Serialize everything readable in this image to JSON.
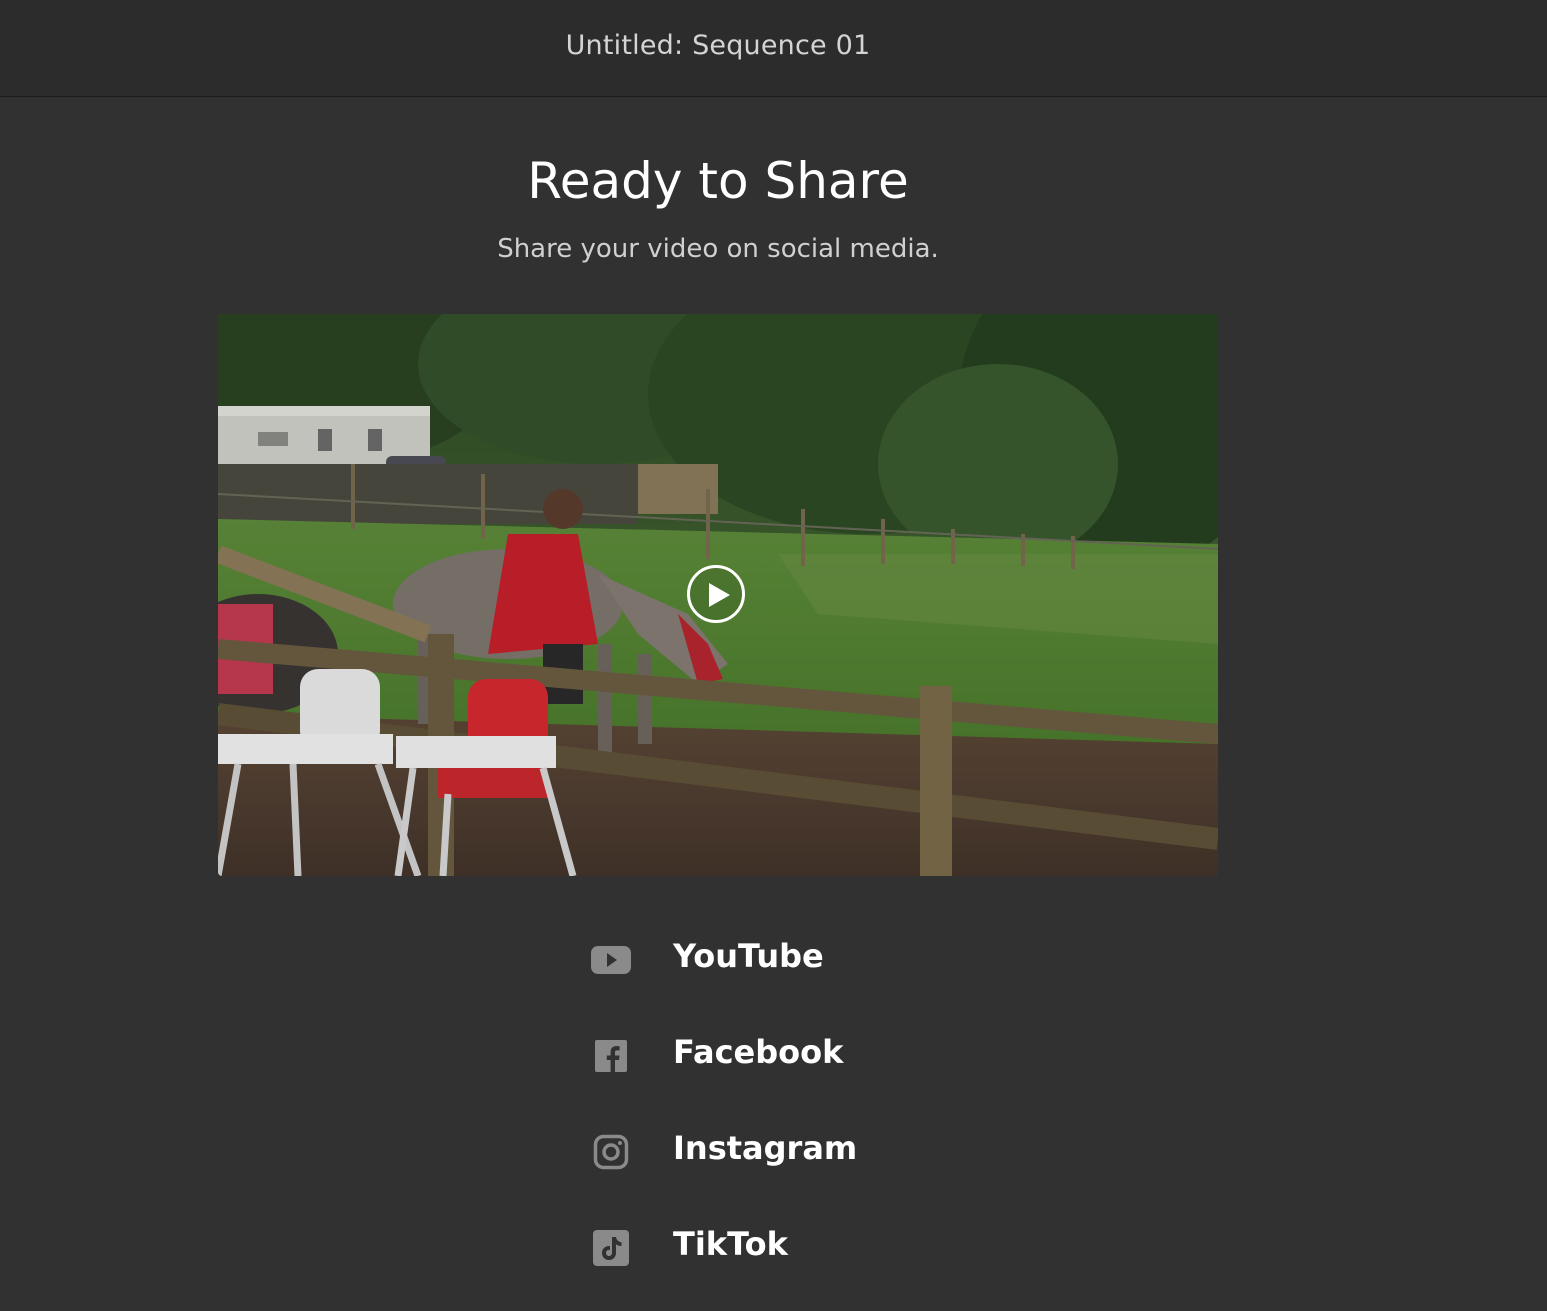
{
  "window": {
    "title": "Untitled: Sequence 01"
  },
  "main": {
    "heading": "Ready to Share",
    "subheading": "Share your video on social media."
  },
  "video": {
    "play_icon": "play-icon"
  },
  "share": {
    "items": [
      {
        "label": "YouTube",
        "icon": "youtube-icon"
      },
      {
        "label": "Facebook",
        "icon": "facebook-icon"
      },
      {
        "label": "Instagram",
        "icon": "instagram-icon"
      },
      {
        "label": "TikTok",
        "icon": "tiktok-icon"
      }
    ]
  },
  "colors": {
    "background": "#313131",
    "topbar": "#2c2c2c",
    "icon": "#8a8a8a",
    "text": "#ffffff"
  }
}
